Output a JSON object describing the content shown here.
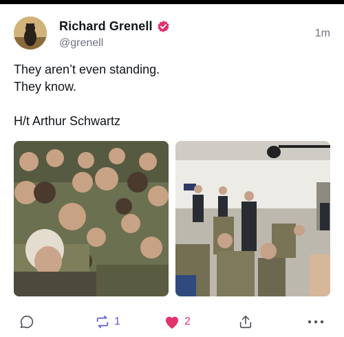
{
  "post": {
    "author": {
      "name": "Richard Grenell",
      "handle": "@grenell",
      "verified": true,
      "avatar_icon": "avatar-photo-dog"
    },
    "timestamp": "1m",
    "text": "They aren’t even standing.\nThey know.\n\nH/t Arthur Schwartz",
    "media": [
      {
        "name": "photo-soldiers-crowd"
      },
      {
        "name": "photo-room-seated-soldiers"
      }
    ],
    "actions": {
      "reply": {
        "icon": "reply-icon",
        "count": ""
      },
      "repost": {
        "icon": "repost-icon",
        "count": "1",
        "color": "#5b5bd6"
      },
      "like": {
        "icon": "heart-icon",
        "count": "2",
        "color": "#e2336b"
      },
      "share": {
        "icon": "share-icon"
      },
      "more": {
        "icon": "more-icon"
      }
    }
  }
}
